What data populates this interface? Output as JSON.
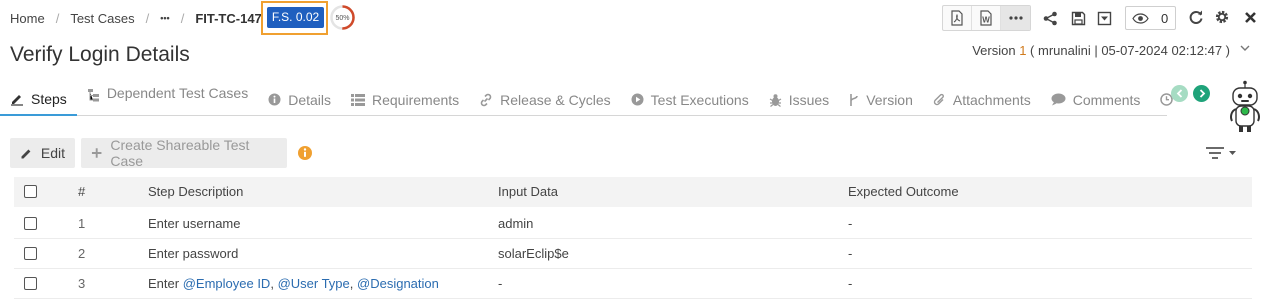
{
  "breadcrumb": {
    "items": [
      "Home",
      "Test Cases",
      "•••"
    ],
    "current": "FIT-TC-147",
    "badge": "F.S. 0.02",
    "progress_label": "50%",
    "progress_value": 0.5
  },
  "toolbar": {
    "views_count": "0",
    "icons": [
      "pdf-icon",
      "word-icon",
      "more-icon",
      "share-icon",
      "save-icon",
      "download-icon",
      "eye-icon",
      "refresh-icon",
      "gear-icon",
      "close-icon"
    ]
  },
  "page": {
    "title": "Verify Login Details",
    "version_prefix": "Version",
    "version_number": "1",
    "version_detail": "( mrunalini | 05-07-2024 02:12:47 )"
  },
  "tabs": [
    {
      "label": "Steps",
      "icon": "edit-icon",
      "active": true
    },
    {
      "label": "Dependent Test Cases",
      "icon": "hierarchy-icon",
      "active": false
    },
    {
      "label": "Details",
      "icon": "info-icon",
      "active": false
    },
    {
      "label": "Requirements",
      "icon": "list-icon",
      "active": false
    },
    {
      "label": "Release & Cycles",
      "icon": "link-icon",
      "active": false
    },
    {
      "label": "Test Executions",
      "icon": "play-icon",
      "active": false
    },
    {
      "label": "Issues",
      "icon": "bug-icon",
      "active": false
    },
    {
      "label": "Version",
      "icon": "branch-icon",
      "active": false
    },
    {
      "label": "Attachments",
      "icon": "paperclip-icon",
      "active": false
    },
    {
      "label": "Comments",
      "icon": "comment-icon",
      "active": false
    }
  ],
  "actions": {
    "edit_label": "Edit",
    "share_label": "Create Shareable Test Case"
  },
  "table": {
    "headers": [
      "#",
      "Step Description",
      "Input Data",
      "Expected Outcome"
    ],
    "rows": [
      {
        "num": "1",
        "desc": "Enter username",
        "input": "admin",
        "outcome": "-"
      },
      {
        "num": "2",
        "desc": "Enter password",
        "input": "solarEclip$e",
        "outcome": "-"
      },
      {
        "num": "3",
        "desc_prefix": "Enter",
        "params": [
          "@Employee ID",
          "@User Type",
          "@Designation"
        ],
        "input": "-",
        "outcome": "-"
      }
    ]
  },
  "colors": {
    "badge_bg": "#1f5fbf",
    "highlight": "#f0a030",
    "active_tab": "#3a9bd8",
    "nav_arrow_light": "#9fd8c0",
    "nav_arrow_dark": "#1fa37a",
    "info": "#f0a030"
  }
}
